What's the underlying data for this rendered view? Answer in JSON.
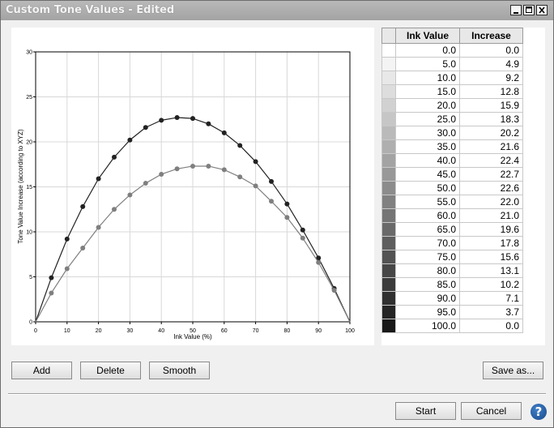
{
  "window": {
    "title": "Custom Tone Values - Edited"
  },
  "window_controls": {
    "minimize_icon": "minimize-icon",
    "maximize_icon": "maximize-icon",
    "close_icon": "close-icon"
  },
  "table": {
    "headers": {
      "ink": "Ink Value",
      "increase": "Increase"
    },
    "rows": [
      {
        "ink": "0.0",
        "inc": "0.0"
      },
      {
        "ink": "5.0",
        "inc": "4.9"
      },
      {
        "ink": "10.0",
        "inc": "9.2"
      },
      {
        "ink": "15.0",
        "inc": "12.8"
      },
      {
        "ink": "20.0",
        "inc": "15.9"
      },
      {
        "ink": "25.0",
        "inc": "18.3"
      },
      {
        "ink": "30.0",
        "inc": "20.2"
      },
      {
        "ink": "35.0",
        "inc": "21.6"
      },
      {
        "ink": "40.0",
        "inc": "22.4"
      },
      {
        "ink": "45.0",
        "inc": "22.7"
      },
      {
        "ink": "50.0",
        "inc": "22.6"
      },
      {
        "ink": "55.0",
        "inc": "22.0"
      },
      {
        "ink": "60.0",
        "inc": "21.0"
      },
      {
        "ink": "65.0",
        "inc": "19.6"
      },
      {
        "ink": "70.0",
        "inc": "17.8"
      },
      {
        "ink": "75.0",
        "inc": "15.6"
      },
      {
        "ink": "80.0",
        "inc": "13.1"
      },
      {
        "ink": "85.0",
        "inc": "10.2"
      },
      {
        "ink": "90.0",
        "inc": "7.1"
      },
      {
        "ink": "95.0",
        "inc": "3.7"
      },
      {
        "ink": "100.0",
        "inc": "0.0"
      }
    ]
  },
  "buttons": {
    "add": "Add",
    "delete": "Delete",
    "smooth": "Smooth",
    "save_as": "Save as...",
    "start": "Start",
    "cancel": "Cancel",
    "help": "?"
  },
  "chart_data": {
    "type": "line",
    "xlabel": "Ink Value (%)",
    "ylabel": "Tone Value Increase (according to XYZ)",
    "xlim": [
      0,
      100
    ],
    "ylim": [
      0,
      30
    ],
    "xticks": [
      "0",
      "10",
      "20",
      "30",
      "40",
      "50",
      "60",
      "70",
      "80",
      "90",
      "100"
    ],
    "yticks": [
      "0",
      "5",
      "10",
      "15",
      "20",
      "25",
      "30"
    ],
    "grid": true,
    "series": [
      {
        "color": "#222222",
        "x": [
          0,
          5,
          10,
          15,
          20,
          25,
          30,
          35,
          40,
          45,
          50,
          55,
          60,
          65,
          70,
          75,
          80,
          85,
          90,
          95,
          100
        ],
        "y": [
          0,
          4.9,
          9.2,
          12.8,
          15.9,
          18.3,
          20.2,
          21.6,
          22.4,
          22.7,
          22.6,
          22.0,
          21.0,
          19.6,
          17.8,
          15.6,
          13.1,
          10.2,
          7.1,
          3.7,
          0
        ]
      },
      {
        "color": "#7f7f7f",
        "x": [
          0,
          5,
          10,
          15,
          20,
          25,
          30,
          35,
          40,
          45,
          50,
          55,
          60,
          65,
          70,
          75,
          80,
          85,
          90,
          95,
          100
        ],
        "y": [
          0,
          3.2,
          5.9,
          8.2,
          10.5,
          12.5,
          14.1,
          15.4,
          16.4,
          17.0,
          17.3,
          17.3,
          16.9,
          16.1,
          15.1,
          13.4,
          11.6,
          9.3,
          6.6,
          3.5,
          0
        ]
      }
    ]
  }
}
